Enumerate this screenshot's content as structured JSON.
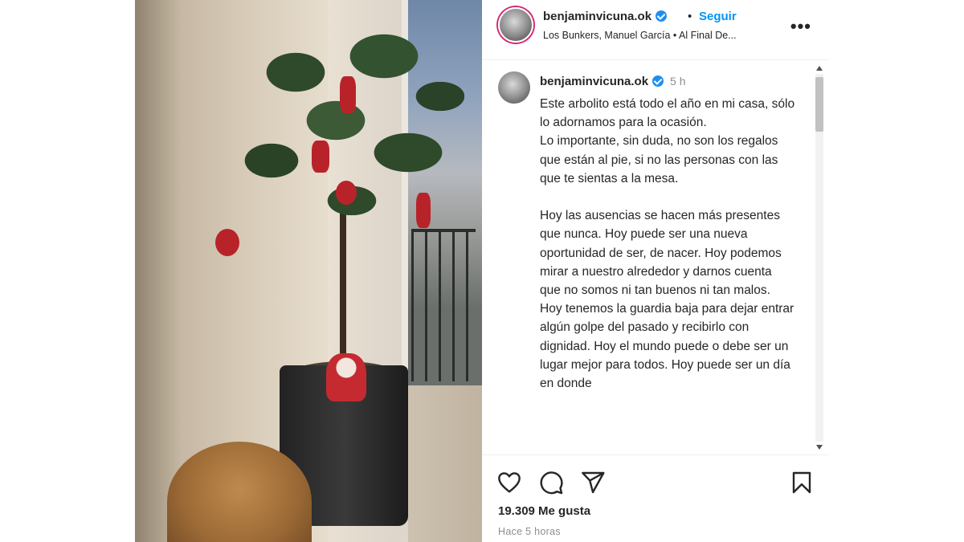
{
  "post": {
    "header": {
      "username": "benjaminvicuna.ok",
      "follow_label": "Seguir",
      "separator": "•",
      "audio": "Los Bunkers, Manuel García • Al Final De...",
      "more_label": "•••"
    },
    "caption": {
      "username": "benjaminvicuna.ok",
      "time": "5 h",
      "text": "Este arbolito está todo el año en mi casa, sólo lo adornamos para la ocasión.\nLo importante, sin duda, no son los regalos que están al pie, si no las personas con las que te sientas a la mesa.\n\nHoy las ausencias se hacen más presentes que nunca. Hoy puede ser una nueva oportunidad de ser, de nacer. Hoy podemos mirar a nuestro alrededor y darnos cuenta que no somos ni tan buenos ni tan malos. Hoy tenemos la guardia baja para dejar entrar algún golpe del pasado y recibirlo con dignidad. Hoy el mundo puede o debe ser un lugar mejor para todos. Hoy puede ser un día en donde"
    },
    "actions": {
      "likes": "19.309 Me gusta",
      "timestamp": "Hace 5 horas"
    },
    "icons": [
      "heart-icon",
      "comment-icon",
      "share-icon",
      "bookmark-icon",
      "verified-icon"
    ]
  }
}
